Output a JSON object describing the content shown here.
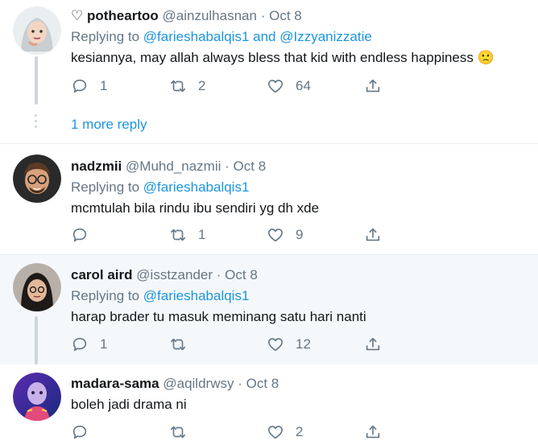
{
  "tweets": [
    {
      "name": "potheartoo",
      "name_prefix": "♡",
      "handle": "@ainzulhasnan",
      "separator": "·",
      "date": "Oct 8",
      "reply_label": "Replying to",
      "mentions": [
        "@farieshabalqis1",
        "@Izzyanizzatie"
      ],
      "mention_joiner": "and",
      "text": "kesiannya, may allah always bless that kid with endless happiness 🙁",
      "counts": {
        "replies": "1",
        "retweets": "2",
        "likes": "64"
      }
    },
    {
      "name": "nadzmii",
      "handle": "@Muhd_nazmii",
      "separator": "·",
      "date": "Oct 8",
      "reply_label": "Replying to",
      "mentions": [
        "@farieshabalqis1"
      ],
      "text": "mcmtulah bila rindu ibu sendiri yg dh xde",
      "counts": {
        "replies": "",
        "retweets": "1",
        "likes": "9"
      }
    },
    {
      "name": "carol aird",
      "handle": "@isstzander",
      "separator": "·",
      "date": "Oct 8",
      "reply_label": "Replying to",
      "mentions": [
        "@farieshabalqis1"
      ],
      "text": "harap brader tu masuk meminang satu hari nanti",
      "counts": {
        "replies": "1",
        "retweets": "",
        "likes": "12"
      }
    },
    {
      "name": "madara-sama",
      "handle": "@aqildrwsy",
      "separator": "·",
      "date": "Oct 8",
      "text": "boleh jadi drama ni",
      "counts": {
        "replies": "",
        "retweets": "",
        "likes": "2"
      }
    }
  ],
  "more_replies": "1 more reply",
  "icons": [
    "reply-icon",
    "retweet-icon",
    "like-icon",
    "share-icon"
  ],
  "colors": {
    "link": "#1b95e0",
    "muted": "#657786",
    "highlight_bg": "#f5f8fa",
    "divider": "#e6ecf0"
  }
}
